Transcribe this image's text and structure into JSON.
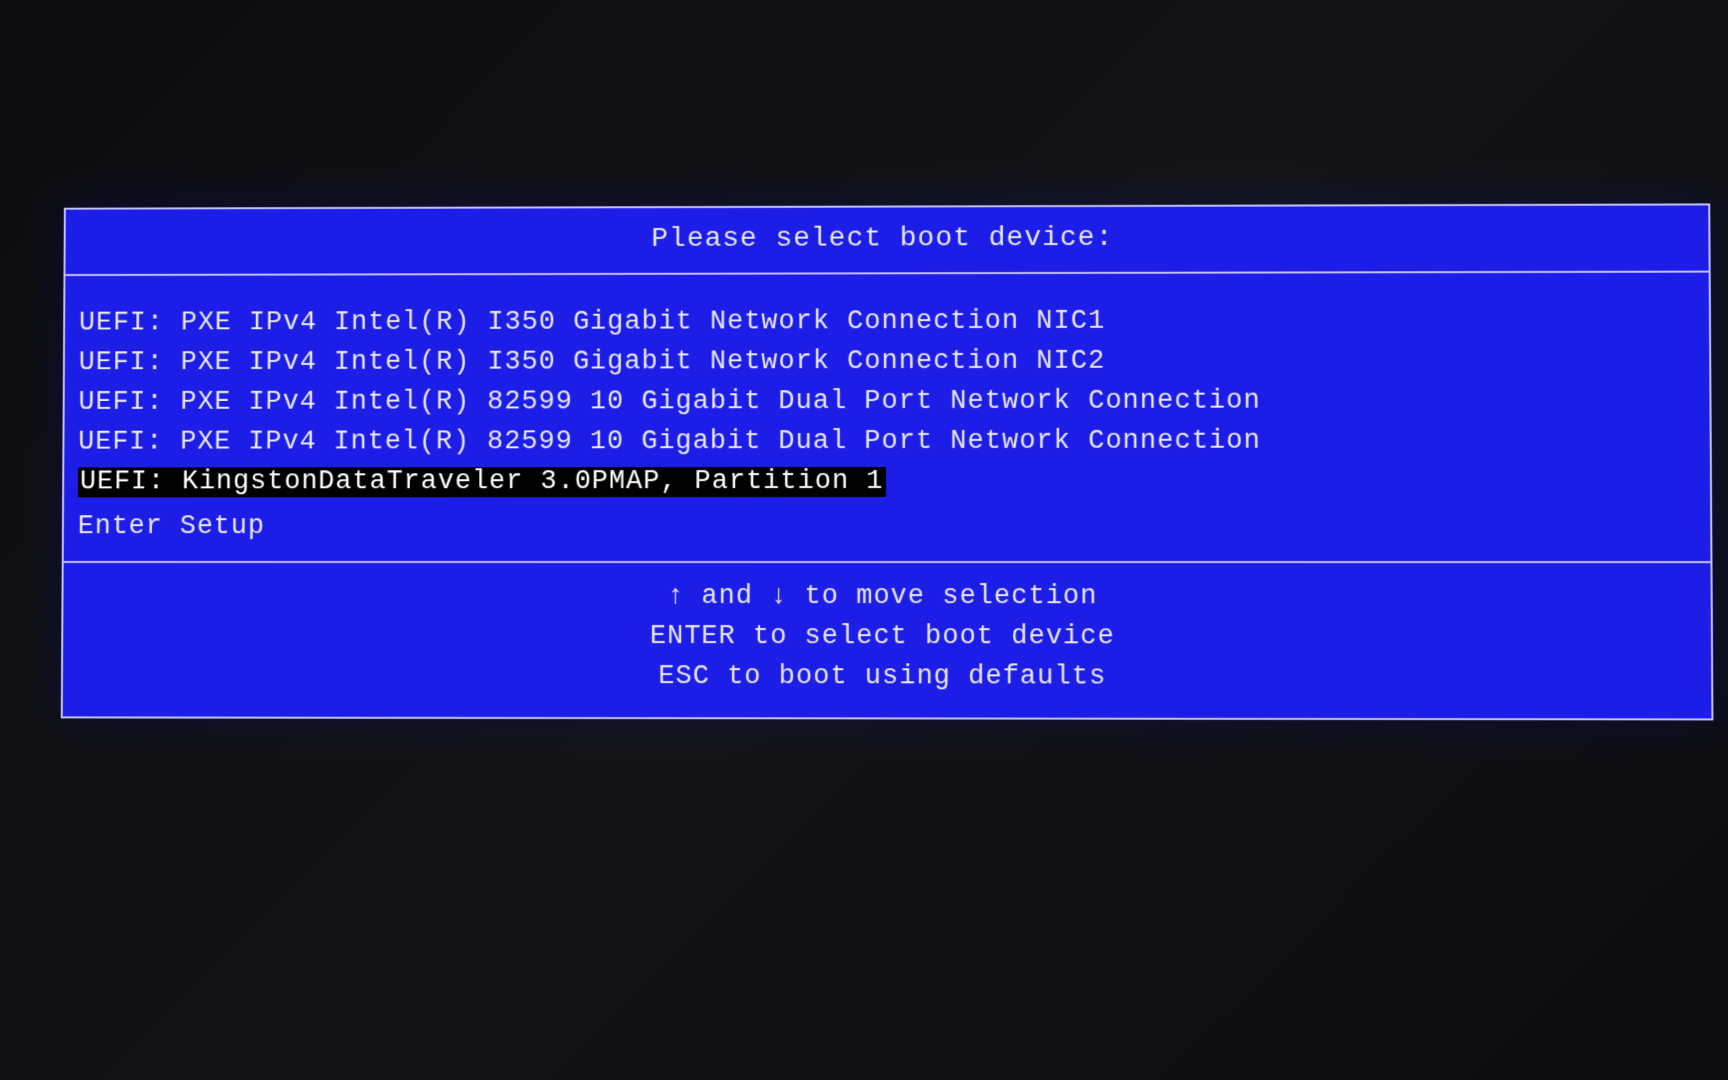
{
  "panel": {
    "title": "Please select boot device:"
  },
  "devices": [
    {
      "label": "UEFI: PXE IPv4 Intel(R) I350 Gigabit Network Connection NIC1",
      "selected": false
    },
    {
      "label": "UEFI: PXE IPv4 Intel(R) I350 Gigabit Network Connection NIC2",
      "selected": false
    },
    {
      "label": "UEFI: PXE IPv4 Intel(R) 82599 10 Gigabit Dual Port Network Connection",
      "selected": false
    },
    {
      "label": "UEFI: PXE IPv4 Intel(R) 82599 10 Gigabit Dual Port Network Connection",
      "selected": false
    },
    {
      "label": "UEFI: KingstonDataTraveler 3.0PMAP, Partition 1",
      "selected": true
    },
    {
      "label": "Enter Setup",
      "selected": false
    }
  ],
  "help": {
    "line1_pre": "",
    "arrow_up": "↑",
    "line1_mid": " and ",
    "arrow_down": "↓",
    "line1_post": " to move selection",
    "line2": "ENTER to select boot device",
    "line3": "ESC to boot using defaults"
  }
}
